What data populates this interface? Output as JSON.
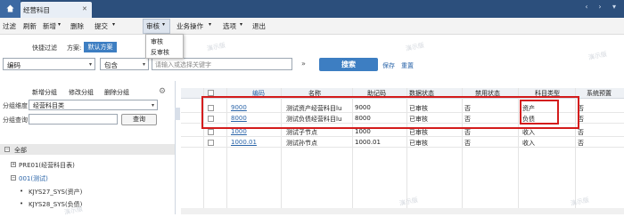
{
  "tabbar": {
    "tab_label": "经营科目",
    "close_glyph": "✕",
    "right_icons": [
      "‹",
      "›",
      "▾"
    ]
  },
  "toolbar": {
    "items": [
      "过滤",
      "刷新",
      "新增",
      "删除",
      "提交",
      "审核",
      "业务操作",
      "选项",
      "退出"
    ],
    "arrow": "▾"
  },
  "audit_menu": {
    "items": [
      "审核",
      "反审核"
    ]
  },
  "quick_filter": {
    "label": "快捷过滤",
    "scheme_label": "方案:",
    "scheme_button": "默认方案"
  },
  "filter": {
    "field": "编码",
    "operator": "包含",
    "placeholder": "请输入或选择关键字",
    "expand_glyph": "»",
    "search_button": "搜索",
    "save": "保存",
    "reset": "重置"
  },
  "left_panel": {
    "add_group": "新增分组",
    "edit_group": "修改分组",
    "delete_group": "删除分组",
    "dimension_label": "分组维度",
    "dimension_value": "经营科目类",
    "query_label": "分组查询",
    "query_button": "查询"
  },
  "tree": {
    "root": "全部",
    "items": [
      "PRE01(经营科目表)",
      "001(测试)",
      "KJYS27_SYS(资产)",
      "KJYS28_SYS(负债)"
    ]
  },
  "grid": {
    "columns": [
      "编码",
      "名称",
      "助记码",
      "数据状态",
      "禁用状态",
      "科目类型",
      "系统预置"
    ],
    "rows": [
      {
        "code": "9000",
        "name": "测试资产经营科目lu",
        "mnemonic": "9000",
        "data_status": "已审核",
        "disabled": "否",
        "type": "资产",
        "preset": "否"
      },
      {
        "code": "8000",
        "name": "测试负债经营科目lu",
        "mnemonic": "8000",
        "data_status": "已审核",
        "disabled": "否",
        "type": "负债",
        "preset": "否"
      },
      {
        "code": "1000",
        "name": "测试子节点",
        "mnemonic": "1000",
        "data_status": "已审核",
        "disabled": "否",
        "type": "收入",
        "preset": "否"
      },
      {
        "code": "1000.01",
        "name": "测试孙节点",
        "mnemonic": "1000.01",
        "data_status": "已审核",
        "disabled": "否",
        "type": "收入",
        "preset": "否"
      }
    ]
  },
  "colors": {
    "accent": "#3d7ec2",
    "tabbar": "#2c4f7c",
    "highlight": "#d41c1c",
    "link": "#2a64a8"
  },
  "icons": [
    "home-icon",
    "gear-icon",
    "expand-icon",
    "close-icon",
    "chevron-down-icon",
    "row-pointer-icon"
  ],
  "watermark": "演示版"
}
